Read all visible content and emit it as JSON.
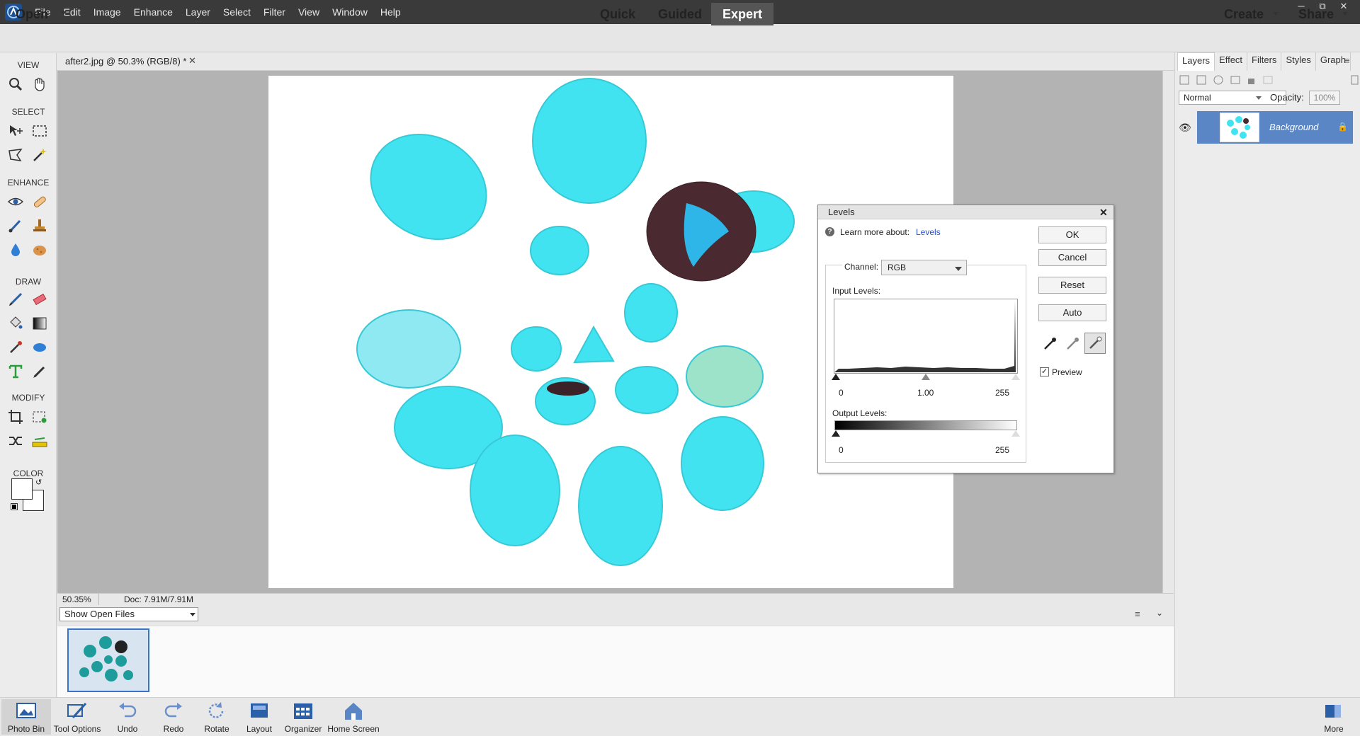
{
  "menubar": {
    "items": [
      "File",
      "Edit",
      "Image",
      "Enhance",
      "Layer",
      "Select",
      "Filter",
      "View",
      "Window",
      "Help"
    ]
  },
  "modebar": {
    "open": "Open",
    "modes": [
      "Quick",
      "Guided",
      "Expert"
    ],
    "active_mode": "Expert",
    "create": "Create",
    "share": "Share"
  },
  "toolbox": {
    "sections": [
      "VIEW",
      "SELECT",
      "ENHANCE",
      "DRAW",
      "MODIFY",
      "COLOR"
    ]
  },
  "document": {
    "tab_title": "after2.jpg @ 50.3% (RGB/8) *",
    "zoom": "50.35%",
    "doc_info": "Doc: 7.91M/7.91M"
  },
  "bin": {
    "selector": "Show Open Files"
  },
  "layers_panel": {
    "tabs": [
      "Layers",
      "Effect",
      "Filters",
      "Styles",
      "Graph"
    ],
    "active_tab": "Layers",
    "blend_mode": "Normal",
    "opacity_label": "Opacity:",
    "opacity_value": "100%",
    "layer_name": "Background"
  },
  "levels_dialog": {
    "title": "Levels",
    "learn_more": "Learn more about:",
    "learn_link": "Levels",
    "channel_label": "Channel:",
    "channel_value": "RGB",
    "input_label": "Input Levels:",
    "input_values": [
      "0",
      "1.00",
      "255"
    ],
    "output_label": "Output Levels:",
    "output_values": [
      "0",
      "255"
    ],
    "buttons": [
      "OK",
      "Cancel",
      "Reset",
      "Auto"
    ],
    "preview_label": "Preview",
    "preview_checked": true
  },
  "taskbar": {
    "items": [
      "Photo Bin",
      "Tool Options",
      "Undo",
      "Redo",
      "Rotate",
      "Layout",
      "Organizer",
      "Home Screen"
    ],
    "more": "More"
  },
  "colors": {
    "accent": "#3a74c9",
    "stone": "#3fe0ef",
    "dark_stone": "#4a2a30"
  }
}
